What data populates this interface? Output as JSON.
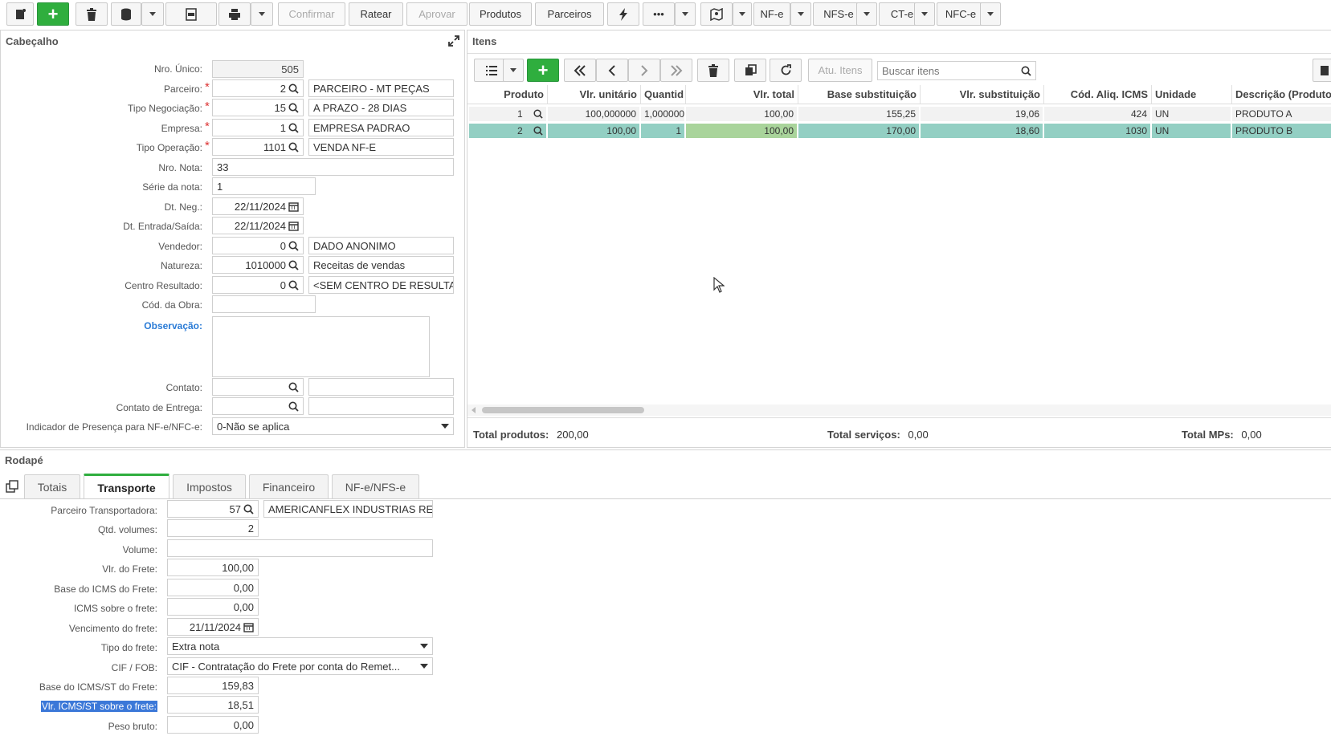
{
  "toolbar": {
    "confirmar": "Confirmar",
    "ratear": "Ratear",
    "aprovar": "Aprovar",
    "produtos": "Produtos",
    "parceiros": "Parceiros",
    "more": "•••",
    "nfe": "NF-e",
    "nfse": "NFS-e",
    "cte": "CT-e",
    "nfce": "NFC-e"
  },
  "cabecalho": {
    "title": "Cabeçalho",
    "nro_unico": {
      "label": "Nro. Único:",
      "value": "505"
    },
    "parceiro": {
      "label": "Parceiro:",
      "code": "2",
      "name": "PARCEIRO - MT PEÇAS"
    },
    "tipo_negociacao": {
      "label": "Tipo Negociação:",
      "code": "15",
      "name": "A PRAZO - 28 DIAS"
    },
    "empresa": {
      "label": "Empresa:",
      "code": "1",
      "name": "EMPRESA PADRAO"
    },
    "tipo_operacao": {
      "label": "Tipo Operação:",
      "code": "1101",
      "name": "VENDA NF-E"
    },
    "nro_nota": {
      "label": "Nro. Nota:",
      "value": "33"
    },
    "serie_nota": {
      "label": "Série da nota:",
      "value": "1"
    },
    "dt_neg": {
      "label": "Dt. Neg.:",
      "value": "22/11/2024"
    },
    "dt_entrada": {
      "label": "Dt. Entrada/Saída:",
      "value": "22/11/2024"
    },
    "vendedor": {
      "label": "Vendedor:",
      "code": "0",
      "name": "DADO ANONIMO"
    },
    "natureza": {
      "label": "Natureza:",
      "code": "1010000",
      "name": "Receitas de vendas"
    },
    "centro_resultado": {
      "label": "Centro Resultado:",
      "code": "0",
      "name": "<SEM CENTRO DE RESULTADO>"
    },
    "cod_obra": {
      "label": "Cód. da Obra:",
      "value": ""
    },
    "observacao": {
      "label": "Observação:",
      "value": ""
    },
    "contato": {
      "label": "Contato:",
      "code": "",
      "name": ""
    },
    "contato_entrega": {
      "label": "Contato de Entrega:",
      "code": "",
      "name": ""
    },
    "indicador": {
      "label": "Indicador de Presença para NF-e/NFC-e:",
      "value": "0-Não se aplica"
    }
  },
  "itens": {
    "title": "Itens",
    "atu_itens": "Atu. Itens",
    "search_placeholder": "Buscar itens",
    "columns": [
      "Produto",
      "Vlr. unitário",
      "Quantid",
      "Vlr. total",
      "Base substituição",
      "Vlr. substituição",
      "Cód. Aliq. ICMS",
      "Unidade",
      "Descrição (Produto)"
    ],
    "rows": [
      {
        "produto": "1",
        "vlr_unit": "100,000000",
        "qtd": "1,000000",
        "vlr_total": "100,00",
        "base_subst": "155,25",
        "vlr_subst": "19,06",
        "cod_aliq": "424",
        "unidade": "UN",
        "descricao": "PRODUTO A"
      },
      {
        "produto": "2",
        "vlr_unit": "100,00",
        "qtd": "1",
        "vlr_total": "100,00",
        "base_subst": "170,00",
        "vlr_subst": "18,60",
        "cod_aliq": "1030",
        "unidade": "UN",
        "descricao": "PRODUTO B"
      }
    ],
    "totals": {
      "produtos_label": "Total produtos:",
      "produtos_value": "200,00",
      "servicos_label": "Total serviços:",
      "servicos_value": "0,00",
      "mps_label": "Total MPs:",
      "mps_value": "0,00"
    }
  },
  "rodape": {
    "title": "Rodapé",
    "tabs": [
      "Totais",
      "Transporte",
      "Impostos",
      "Financeiro",
      "NF-e/NFS-e"
    ],
    "parceiro_transp": {
      "label": "Parceiro Transportadora:",
      "code": "57",
      "name": "AMERICANFLEX INDUSTRIAS REUNIDAS"
    },
    "qtd_volumes": {
      "label": "Qtd. volumes:",
      "value": "2"
    },
    "volume": {
      "label": "Volume:",
      "value": ""
    },
    "vlr_frete": {
      "label": "Vlr. do Frete:",
      "value": "100,00"
    },
    "base_icms_frete": {
      "label": "Base do ICMS do Frete:",
      "value": "0,00"
    },
    "icms_frete": {
      "label": "ICMS sobre o frete:",
      "value": "0,00"
    },
    "venc_frete": {
      "label": "Vencimento do frete:",
      "value": "21/11/2024"
    },
    "tipo_frete": {
      "label": "Tipo do frete:",
      "value": "Extra nota"
    },
    "cif_fob": {
      "label": "CIF / FOB:",
      "value": "CIF - Contratação do Frete por conta do Remet..."
    },
    "base_icmsst_frete": {
      "label": "Base do ICMS/ST do Frete:",
      "value": "159,83"
    },
    "vlr_icmsst_frete": {
      "label": "Vlr. ICMS/ST sobre o frete:",
      "value": "18,51"
    },
    "peso_bruto": {
      "label": "Peso bruto:",
      "value": "0,00"
    }
  }
}
